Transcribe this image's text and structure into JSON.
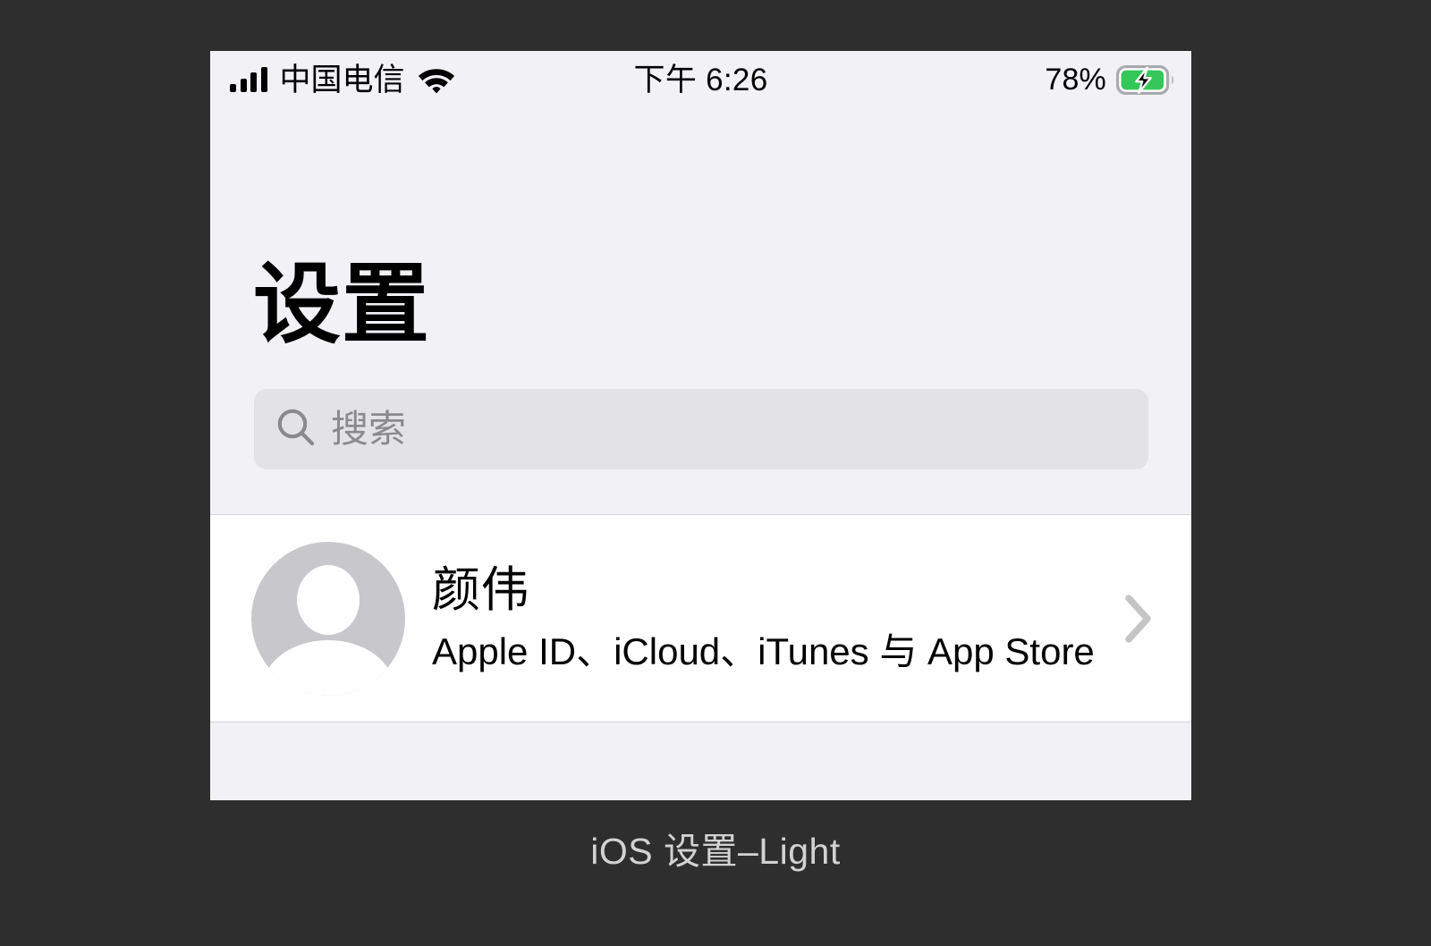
{
  "caption": "iOS 设置–Light",
  "status_bar": {
    "signal_icon": "signal-bars-icon",
    "carrier": "中国电信",
    "wifi_icon": "wifi-icon",
    "time": "下午 6:26",
    "battery_percent": "78%",
    "battery_icon": "battery-charging-icon",
    "battery_level": 78,
    "battery_charging": true
  },
  "header": {
    "title": "设置"
  },
  "search": {
    "icon": "search-icon",
    "placeholder": "搜索",
    "value": ""
  },
  "account": {
    "avatar_icon": "person-avatar-icon",
    "name": "颜伟",
    "subtitle": "Apple ID、iCloud、iTunes 与 App Store",
    "chevron_icon": "chevron-right-icon"
  },
  "colors": {
    "page_background": "#2e2e2e",
    "screen_background": "#f2f1f6",
    "card_background": "#ffffff",
    "search_field": "#e3e2e7",
    "separator": "#d4d3d8",
    "avatar_gray": "#c7c7cc",
    "chevron_gray": "#c5c5c7",
    "placeholder_gray": "#8a8a8e",
    "battery_green": "#34c759",
    "caption_text": "#d2d2d2"
  }
}
